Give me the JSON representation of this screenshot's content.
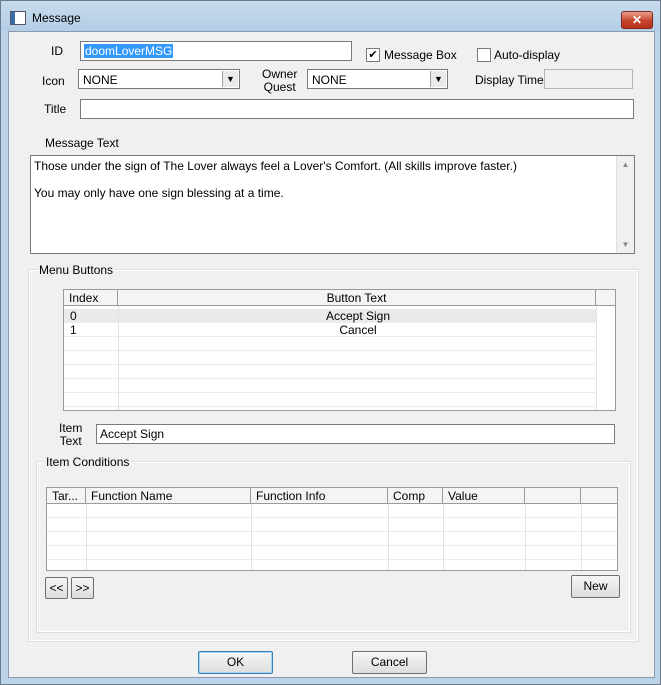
{
  "window": {
    "title": "Message",
    "close_glyph": "✕"
  },
  "labels": {
    "id": "ID",
    "icon": "Icon",
    "owner_quest": "Owner\nQuest",
    "title": "Title",
    "display_time": "Display Time",
    "message_text": "Message Text",
    "menu_buttons": "Menu Buttons",
    "item_text": "Item\nText",
    "item_conditions": "Item Conditions"
  },
  "fields": {
    "id_value": "doomLoverMSG",
    "title_value": "",
    "display_time_value": "",
    "item_text_value": "Accept Sign"
  },
  "combos": {
    "icon_value": "NONE",
    "owner_quest_value": "NONE"
  },
  "checkboxes": {
    "message_box": {
      "label": "Message Box",
      "checked": true,
      "mark": "✔"
    },
    "auto_display": {
      "label": "Auto-display",
      "checked": false,
      "mark": ""
    }
  },
  "message_text": {
    "line1": "Those under the sign of The Lover always feel a Lover's Comfort. (All skills improve faster.)",
    "line2": "You may only have one sign blessing at a time."
  },
  "menu_grid": {
    "headers": [
      "Index",
      "Button Text"
    ],
    "rows": [
      {
        "index": "0",
        "text": "Accept Sign"
      },
      {
        "index": "1",
        "text": "Cancel"
      }
    ]
  },
  "conditions_grid": {
    "headers": [
      "Tar...",
      "Function Name",
      "Function Info",
      "Comp",
      "Value"
    ]
  },
  "buttons": {
    "prev": "<<",
    "next": ">>",
    "new": "New",
    "ok": "OK",
    "cancel": "Cancel"
  },
  "colors": {
    "title_bar": "#bcd3ea",
    "selection": "#3399ff",
    "close_button": "#c6432a"
  }
}
